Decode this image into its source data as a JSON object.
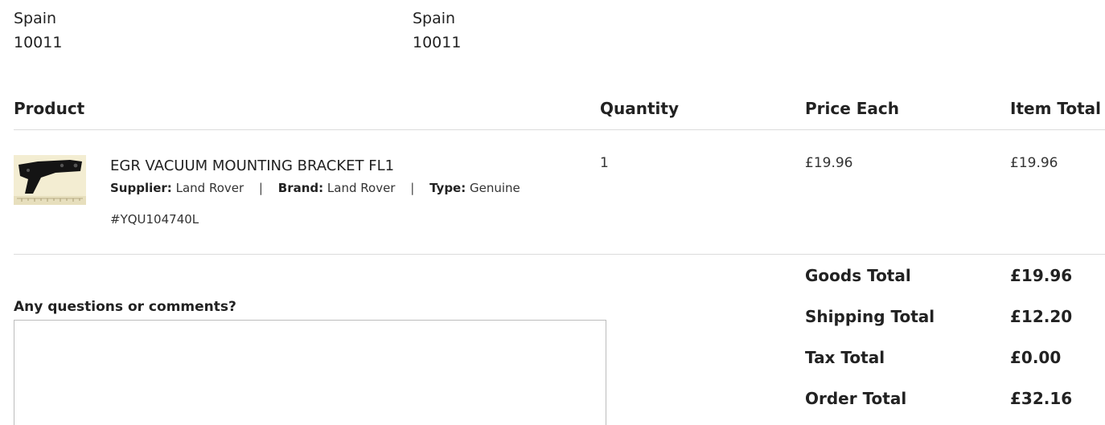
{
  "billing_address": {
    "country": "Spain",
    "postcode": "10011"
  },
  "shipping_address": {
    "country": "Spain",
    "postcode": "10011"
  },
  "table": {
    "headers": {
      "product": "Product",
      "quantity": "Quantity",
      "price_each": "Price Each",
      "item_total": "Item Total"
    }
  },
  "items": [
    {
      "name": "EGR VACUUM MOUNTING BRACKET FL1",
      "supplier_label": "Supplier:",
      "supplier": "Land Rover",
      "brand_label": "Brand:",
      "brand": "Land Rover",
      "type_label": "Type:",
      "type": "Genuine",
      "separator": "|",
      "sku": "#YQU104740L",
      "quantity": "1",
      "price_each": "£19.96",
      "item_total": "£19.96",
      "image_icon": "product-photo-bracket"
    }
  ],
  "summary": {
    "goods_label": "Goods Total",
    "goods": "£19.96",
    "shipping_label": "Shipping Total",
    "shipping": "£12.20",
    "tax_label": "Tax Total",
    "tax": "£0.00",
    "order_label": "Order Total",
    "order": "£32.16"
  },
  "comments": {
    "label": "Any questions or comments?",
    "value": ""
  }
}
